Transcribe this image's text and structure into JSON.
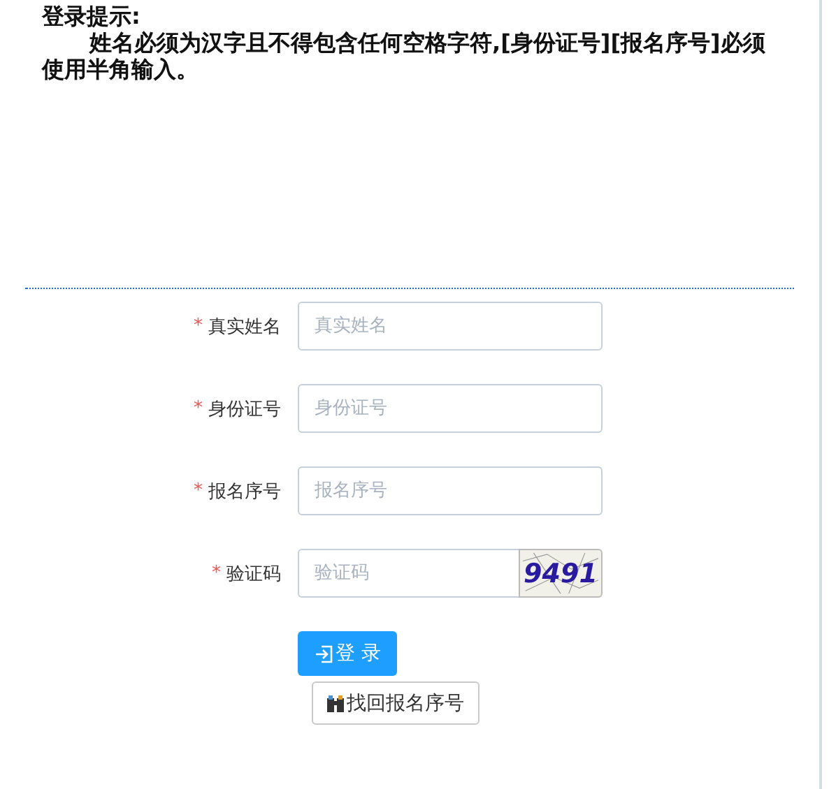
{
  "notice": {
    "title": "登录提示:",
    "body": "姓名必须为汉字且不得包含任何空格字符,[身份证号][报名序号]必须使用半角输入。"
  },
  "fields": [
    {
      "mark": "*",
      "label": "真实姓名",
      "placeholder": "真实姓名",
      "kind": "text"
    },
    {
      "mark": "*",
      "label": "身份证号",
      "placeholder": "身份证号",
      "kind": "text"
    },
    {
      "mark": "*",
      "label": "报名序号",
      "placeholder": "报名序号",
      "kind": "text"
    },
    {
      "mark": "*",
      "label": "验证码",
      "placeholder": "验证码",
      "kind": "captcha",
      "captcha": "9491"
    }
  ],
  "login_button": "登 录",
  "recover_button": "找回报名序号"
}
